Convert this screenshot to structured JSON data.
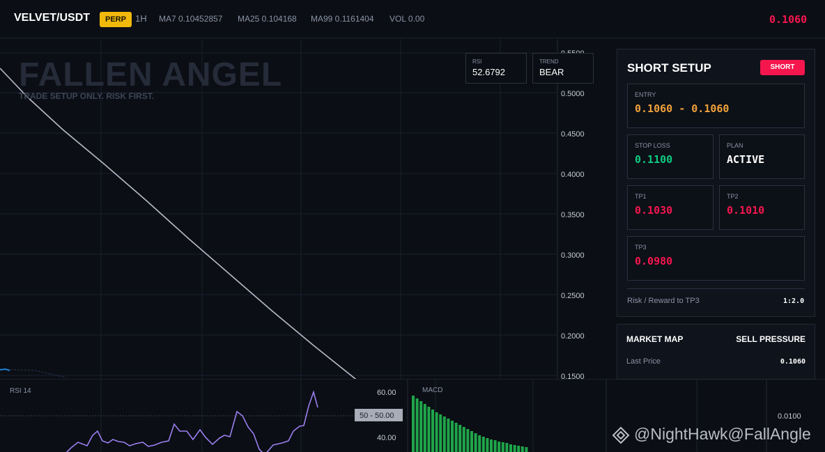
{
  "header": {
    "symbol": "VELVET/USDT",
    "contract_badge": "PERP",
    "timeframe": "1H",
    "ma7": "MA7 0.10452857",
    "ma25": "MA25 0.104168",
    "ma99": "MA99 0.1161404",
    "volume": "VOL 0.00",
    "last_price": "0.1060"
  },
  "chart": {
    "watermark_title": "FALLEN ANGEL",
    "watermark_subtitle": "TRADE SETUP ONLY. RISK FIRST.",
    "rsi_box": {
      "label": "RSI",
      "value": "52.6792"
    },
    "trend_box": {
      "label": "TREND",
      "value": "BEAR"
    },
    "price_axis": [
      "0.5500",
      "0.5000",
      "0.4500",
      "0.4000",
      "0.3500",
      "0.3000",
      "0.2500",
      "0.2000",
      "0.1500"
    ]
  },
  "lower": {
    "rsi_title": "RSI 14",
    "rsi_axis": [
      "60.00",
      "40.00"
    ],
    "rsi_marker": "50 - 50.00",
    "macd_title": "MACD",
    "macd_axis": "0.0100"
  },
  "setup": {
    "title": "SHORT SETUP",
    "side_badge": "SHORT",
    "entry": {
      "label": "ENTRY",
      "value": "0.1060 - 0.1060"
    },
    "stop_loss": {
      "label": "STOP LOSS",
      "value": "0.1100"
    },
    "plan": {
      "label": "PLAN",
      "value": "ACTIVE"
    },
    "tp1": {
      "label": "TP1",
      "value": "0.1030"
    },
    "tp2": {
      "label": "TP2",
      "value": "0.1010"
    },
    "tp3": {
      "label": "TP3",
      "value": "0.0980"
    },
    "rr_label": "Risk / Reward to TP3",
    "rr_value": "1:2.0"
  },
  "market_map": {
    "title": "MARKET MAP",
    "status": "SELL PRESSURE",
    "last_price_label": "Last Price",
    "last_price_value": "0.1060"
  },
  "credit": "@NightHawk@FallAngle",
  "colors": {
    "brand_yellow": "#f0b90b",
    "bear_red": "#f6164e",
    "bull_green": "#0ecb81",
    "entry_orange": "#f0a23a",
    "rsi_purple": "#9b7ff0",
    "macd_green": "#1fa54a"
  }
}
